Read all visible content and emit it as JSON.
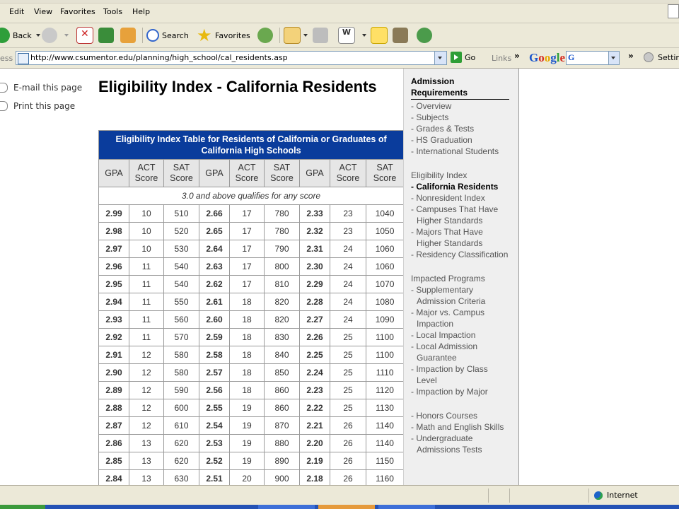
{
  "menus": [
    "Edit",
    "View",
    "Favorites",
    "Tools",
    "Help"
  ],
  "toolbar": {
    "back_label": "Back",
    "search_label": "Search",
    "favorites_label": "Favorites"
  },
  "address": {
    "label": "ess",
    "url": "http://www.csumentor.edu/planning/high_school/cal_residents.asp",
    "go_label": "Go",
    "links_label": "Links"
  },
  "google": {
    "logo": "Google",
    "settings_label": "Settin"
  },
  "side_actions": {
    "email": "E-mail this page",
    "print": "Print this page"
  },
  "page_title": "Eligibility Index - California Residents",
  "table": {
    "caption": "Eligibility Index Table for Residents of California or Graduates of California High Schools",
    "headers": [
      "GPA",
      "ACT Score",
      "SAT Score",
      "GPA",
      "ACT Score",
      "SAT Score",
      "GPA",
      "ACT Score",
      "SAT Score"
    ],
    "note": "3.0 and above qualifies for any score",
    "rows": [
      [
        "2.99",
        "10",
        "510",
        "2.66",
        "17",
        "780",
        "2.33",
        "23",
        "1040"
      ],
      [
        "2.98",
        "10",
        "520",
        "2.65",
        "17",
        "780",
        "2.32",
        "23",
        "1050"
      ],
      [
        "2.97",
        "10",
        "530",
        "2.64",
        "17",
        "790",
        "2.31",
        "24",
        "1060"
      ],
      [
        "2.96",
        "11",
        "540",
        "2.63",
        "17",
        "800",
        "2.30",
        "24",
        "1060"
      ],
      [
        "2.95",
        "11",
        "540",
        "2.62",
        "17",
        "810",
        "2.29",
        "24",
        "1070"
      ],
      [
        "2.94",
        "11",
        "550",
        "2.61",
        "18",
        "820",
        "2.28",
        "24",
        "1080"
      ],
      [
        "2.93",
        "11",
        "560",
        "2.60",
        "18",
        "820",
        "2.27",
        "24",
        "1090"
      ],
      [
        "2.92",
        "11",
        "570",
        "2.59",
        "18",
        "830",
        "2.26",
        "25",
        "1100"
      ],
      [
        "2.91",
        "12",
        "580",
        "2.58",
        "18",
        "840",
        "2.25",
        "25",
        "1100"
      ],
      [
        "2.90",
        "12",
        "580",
        "2.57",
        "18",
        "850",
        "2.24",
        "25",
        "1110"
      ],
      [
        "2.89",
        "12",
        "590",
        "2.56",
        "18",
        "860",
        "2.23",
        "25",
        "1120"
      ],
      [
        "2.88",
        "12",
        "600",
        "2.55",
        "19",
        "860",
        "2.22",
        "25",
        "1130"
      ],
      [
        "2.87",
        "12",
        "610",
        "2.54",
        "19",
        "870",
        "2.21",
        "26",
        "1140"
      ],
      [
        "2.86",
        "13",
        "620",
        "2.53",
        "19",
        "880",
        "2.20",
        "26",
        "1140"
      ],
      [
        "2.85",
        "13",
        "620",
        "2.52",
        "19",
        "890",
        "2.19",
        "26",
        "1150"
      ],
      [
        "2.84",
        "13",
        "630",
        "2.51",
        "20",
        "900",
        "2.18",
        "26",
        "1160"
      ]
    ]
  },
  "sidebar": {
    "heading": "Admission Requirements",
    "group1": [
      "- Overview",
      "- Subjects",
      "- Grades & Tests",
      "- HS Graduation",
      "- International Students"
    ],
    "group2_title": "Eligibility Index",
    "group2": [
      "- California Residents",
      "- Nonresident Index",
      "- Campuses That Have Higher Standards",
      "- Majors That Have Higher Standards",
      "- Residency Classification"
    ],
    "group3_title": "Impacted Programs",
    "group3": [
      "- Supplementary Admission Criteria",
      "- Major vs. Campus Impaction",
      "- Local Impaction",
      "- Local Admission Guarantee",
      "- Impaction by Class Level",
      "- Impaction by Major"
    ],
    "group4": [
      "- Honors Courses",
      "- Math and English Skills",
      "- Undergraduate Admissions Tests"
    ]
  },
  "status": {
    "zone": "Internet"
  },
  "colors": {
    "caption_bg": "#0a3c9c",
    "chrome": "#ece9d8",
    "sidebar_bg": "#efefef"
  }
}
